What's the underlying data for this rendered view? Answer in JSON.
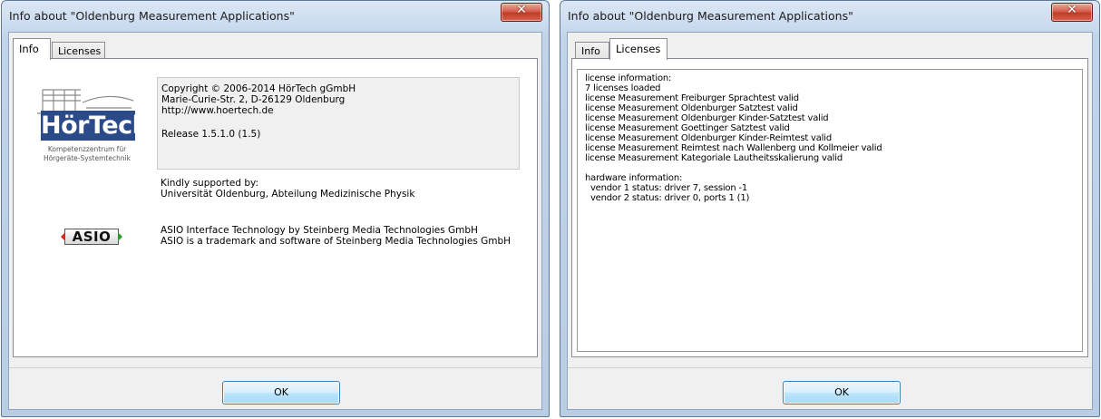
{
  "colors": {
    "frame": "#c1d4ea",
    "client": "#f0f0f0",
    "logo_blue": "#2a4a8a",
    "close_red": "#c13c27",
    "asio_red": "#d42a1c",
    "asio_green": "#2c9a2c"
  },
  "left_window": {
    "title": "Info about \"Oldenburg Measurement Applications\"",
    "close_glyph": "✕",
    "tabs": [
      {
        "label": "Info",
        "active": true
      },
      {
        "label": "Licenses",
        "active": false
      }
    ],
    "logo": {
      "icon": "hoertech-building-logo",
      "word": "HörTech",
      "line1": "Kompetenzzentrum für",
      "line2": "Hörgeräte-Systemtechnik"
    },
    "copyright": {
      "line1": "Copyright © 2006-2014 HörTech gGmbH",
      "line2": "Marie-Curie-Str. 2, D-26129 Oldenburg",
      "line3": "http://www.hoertech.de",
      "release": "Release 1.5.1.0 (1.5)"
    },
    "support": {
      "line1": "Kindly supported by:",
      "line2": "Universität Oldenburg, Abteilung Medizinische Physik"
    },
    "asio": {
      "icon": "asio-logo",
      "logo_text": "ASIO",
      "line1": "ASIO Interface Technology by Steinberg Media Technologies GmbH",
      "line2": "ASIO is a trademark and software of Steinberg Media Technologies GmbH"
    },
    "ok_label": "OK"
  },
  "right_window": {
    "title": "Info about \"Oldenburg Measurement Applications\"",
    "close_glyph": "✕",
    "tabs": [
      {
        "label": "Info",
        "active": false
      },
      {
        "label": "Licenses",
        "active": true
      }
    ],
    "license_lines": [
      "license information:",
      "7 licenses loaded",
      "license Measurement Freiburger Sprachtest valid",
      "license Measurement Oldenburger Satztest valid",
      "license Measurement Oldenburger Kinder-Satztest valid",
      "license Measurement Goettinger Satztest valid",
      "license Measurement Oldenburger Kinder-Reimtest valid",
      "license Measurement Reimtest nach Wallenberg und Kollmeier valid",
      "license Measurement Kategoriale Lautheitsskalierung valid",
      "",
      "hardware information:",
      "  vendor 1 status: driver 7, session -1",
      "  vendor 2 status: driver 0, ports 1 (1)"
    ],
    "ok_label": "OK"
  }
}
